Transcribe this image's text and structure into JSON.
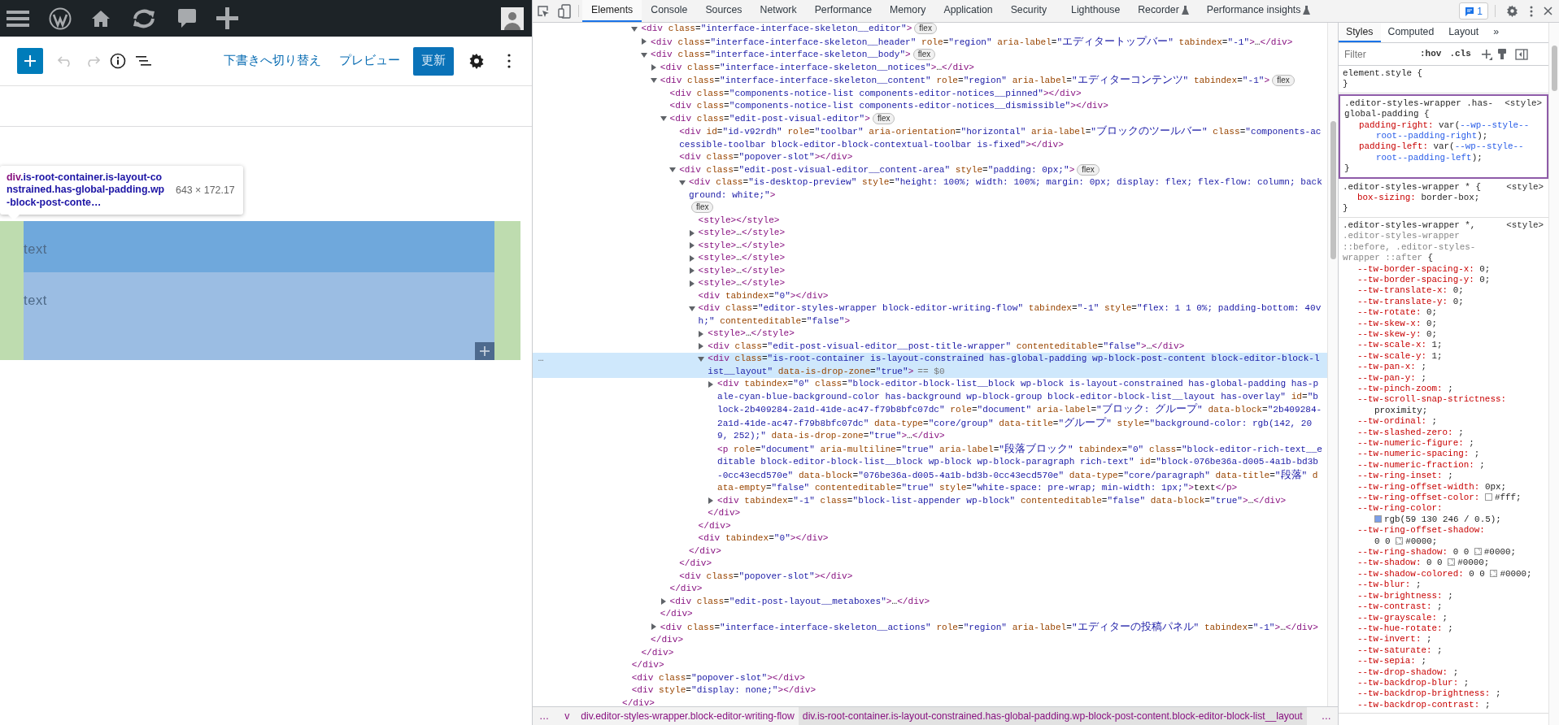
{
  "wp_editor": {
    "toolbar": {
      "undo": {
        "disabled": true
      },
      "redo": {
        "disabled": true
      },
      "links": [
        "下書きへ切り替え",
        "プレビュー"
      ],
      "update_button": "更新"
    },
    "tooltip": {
      "tag": "div",
      "classes": ".is-root-container.is-layout-constrained.has-global-padding.wp-block-post-conte…",
      "size": "643 × 172.17"
    },
    "blocks": [
      {
        "text": "text",
        "color": "#6fa8dc"
      },
      {
        "text": "text",
        "color": "#9bbde3"
      }
    ]
  },
  "devtools": {
    "tabs": [
      {
        "label": "Elements",
        "selected": true,
        "experimental": false
      },
      {
        "label": "Console",
        "selected": false,
        "experimental": false
      },
      {
        "label": "Sources",
        "selected": false,
        "experimental": false
      },
      {
        "label": "Network",
        "selected": false,
        "experimental": false
      },
      {
        "label": "Performance",
        "selected": false,
        "experimental": false
      },
      {
        "label": "Memory",
        "selected": false,
        "experimental": false
      },
      {
        "label": "Application",
        "selected": false,
        "experimental": false
      },
      {
        "label": "Security",
        "selected": false,
        "experimental": false
      },
      {
        "label": "Lighthouse",
        "selected": false,
        "experimental": false
      },
      {
        "label": "Recorder",
        "selected": false,
        "experimental": true
      },
      {
        "label": "Performance insights",
        "selected": false,
        "experimental": true
      }
    ],
    "issues_count": "1",
    "dom": {
      "children": [
        {
          "close": "</div>",
          "children": [
            {
              "close": "</div>",
              "children": [
                {
                  "open": "<div class=\"interface-interface-skeleton__editor\">",
                  "expanded": true,
                  "selected": false,
                  "badge": "flex",
                  "close": "</div>",
                  "children": [
                    {
                      "open": "<div class=\"interface-interface-skeleton__header\" role=\"region\" aria-label=\"エディタートップバー\" tabindex=\"-1\">…</div>",
                      "expanded": false,
                      "selected": false
                    },
                    {
                      "open": "<div class=\"interface-interface-skeleton__body\">",
                      "expanded": true,
                      "selected": false,
                      "badge": "flex",
                      "close": "</div>",
                      "children": [
                        {
                          "open": "<div class=\"interface-interface-skeleton__notices\">…</div>",
                          "expanded": false,
                          "selected": false
                        },
                        {
                          "open": "<div class=\"interface-interface-skeleton__content\" role=\"region\" aria-label=\"エディターコンテンツ\" tabindex=\"-1\">",
                          "expanded": true,
                          "selected": false,
                          "badge": "flex",
                          "close": "</div>",
                          "children": [
                            {
                              "open": "<div class=\"components-notice-list components-editor-notices__pinned\"></div>",
                              "selected": false
                            },
                            {
                              "open": "<div class=\"components-notice-list components-editor-notices__dismissible\"></div>",
                              "selected": false
                            },
                            {
                              "open": "<div class=\"edit-post-visual-editor\">",
                              "expanded": true,
                              "selected": false,
                              "badge": "flex",
                              "close": "</div>",
                              "children": [
                                {
                                  "open": "<div id=\"id-v92rdh\" role=\"toolbar\" aria-orientation=\"horizontal\" aria-label=\"ブロックのツールバー\" class=\"components-accessible-toolbar block-editor-block-contextual-toolbar is-fixed\"></div>",
                                  "selected": false
                                },
                                {
                                  "open": "<div class=\"popover-slot\"></div>",
                                  "selected": false
                                },
                                {
                                  "open": "<div class=\"edit-post-visual-editor__content-area\" style=\"padding: 0px;\">",
                                  "expanded": true,
                                  "selected": false,
                                  "badge": "flex",
                                  "close": "</div>",
                                  "children": [
                                    {
                                      "open": "<div class=\"is-desktop-preview\" style=\"height: 100%; width: 100%; margin: 0px; display: flex; flex-flow: column; background: white;\">",
                                      "expanded": true,
                                      "selected": false,
                                      "badge": "flex",
                                      "close": "</div>",
                                      "children": [
                                        {
                                          "open": "<style></style>",
                                          "selected": false
                                        },
                                        {
                                          "open": "<style>…</style>",
                                          "expanded": false,
                                          "selected": false
                                        },
                                        {
                                          "open": "<style>…</style>",
                                          "expanded": false,
                                          "selected": false
                                        },
                                        {
                                          "open": "<style>…</style>",
                                          "expanded": false,
                                          "selected": false
                                        },
                                        {
                                          "open": "<style>…</style>",
                                          "expanded": false,
                                          "selected": false
                                        },
                                        {
                                          "open": "<style>…</style>",
                                          "expanded": false,
                                          "selected": false
                                        },
                                        {
                                          "open": "<div tabindex=\"0\"></div>",
                                          "selected": false
                                        },
                                        {
                                          "open": "<div class=\"editor-styles-wrapper block-editor-writing-flow\" tabindex=\"-1\" style=\"flex: 1 1 0%; padding-bottom: 40vh;\" contenteditable=\"false\">",
                                          "expanded": true,
                                          "selected": false,
                                          "close": "</div>",
                                          "children": [
                                            {
                                              "open": "<style>…</style>",
                                              "expanded": false,
                                              "selected": false
                                            },
                                            {
                                              "open": "<div class=\"edit-post-visual-editor__post-title-wrapper\" contenteditable=\"false\">…</div>",
                                              "expanded": false,
                                              "selected": false
                                            },
                                            {
                                              "open": "<div class=\"is-root-container is-layout-constrained has-global-padding wp-block-post-content block-editor-block-list__layout\" data-is-drop-zone=\"true\">",
                                              "expanded": true,
                                              "selected": true,
                                              "gutter": "…",
                                              "marker": "== $0",
                                              "close": "</div>",
                                              "children": [
                                                {
                                                  "open": "<div tabindex=\"0\" class=\"block-editor-block-list__block wp-block is-layout-constrained has-global-padding has-pale-cyan-blue-background-color has-background wp-block-group block-editor-block-list__layout has-overlay\" id=\"block-2b409284-2a1d-41de-ac47-f79b8bfc07dc\" role=\"document\" aria-label=\"ブロック: グループ\" data-block=\"2b409284-2a1d-41de-ac47-f79b8bfc07dc\" data-type=\"core/group\" data-title=\"グループ\" style=\"background-color: rgb(142, 209, 252);\" data-is-drop-zone=\"true\">…</div>",
                                                  "expanded": false,
                                                  "selected": false
                                                },
                                                {
                                                  "open": "<p role=\"document\" aria-multiline=\"true\" aria-label=\"段落ブロック\" tabindex=\"0\" class=\"block-editor-rich-text__editable block-editor-block-list__block wp-block wp-block-paragraph rich-text\" id=\"block-076be36a-d005-4a1b-bd3b-0cc43ecd570e\" data-block=\"076be36a-d005-4a1b-bd3b-0cc43ecd570e\" data-type=\"core/paragraph\" data-title=\"段落\" data-empty=\"false\" contenteditable=\"true\" style=\"white-space: pre-wrap; min-width: 1px;\">text</p>",
                                                  "selected": false
                                                },
                                                {
                                                  "open": "<div tabindex=\"-1\" class=\"block-list-appender wp-block\" contenteditable=\"false\" data-block=\"true\">…</div>",
                                                  "expanded": false,
                                                  "selected": false
                                                }
                                              ]
                                            }
                                          ]
                                        },
                                        {
                                          "open": "<div tabindex=\"0\"></div>",
                                          "selected": false
                                        }
                                      ]
                                    }
                                  ]
                                },
                                {
                                  "open": "<div class=\"popover-slot\"></div>",
                                  "selected": false
                                }
                              ]
                            },
                            {
                              "open": "<div class=\"edit-post-layout__metaboxes\">…</div>",
                              "expanded": false,
                              "selected": false
                            }
                          ]
                        },
                        {
                          "open": "<div class=\"interface-interface-skeleton__actions\" role=\"region\" aria-label=\"エディターの投稿パネル\" tabindex=\"-1\">…</div>",
                          "expanded": false,
                          "selected": false
                        }
                      ]
                    }
                  ]
                }
              ]
            },
            {
              "open": "<div class=\"popover-slot\"></div>",
              "selected": false
            },
            {
              "open": "<div style=\"display: none;\"></div>",
              "selected": false
            }
          ]
        }
      ]
    },
    "breadcrumbs": {
      "lead": "…",
      "items": [
        {
          "text": "v",
          "selected": false
        },
        {
          "text": "div.editor-styles-wrapper.block-editor-writing-flow",
          "selected": false
        },
        {
          "text": "div.is-root-container.is-layout-constrained.has-global-padding.wp-block-post-content.block-editor-block-list__layout",
          "selected": true
        }
      ],
      "tail": "…"
    },
    "styles_tabs": [
      {
        "label": "Styles",
        "selected": true
      },
      {
        "label": "Computed",
        "selected": false
      },
      {
        "label": "Layout",
        "selected": false
      }
    ],
    "styles_more": "»",
    "filter": {
      "placeholder": "Filter",
      "buttons": [
        ":hov",
        ".cls"
      ]
    },
    "rules": [
      {
        "selector": [
          {
            "text": "element.style {",
            "matched": true
          }
        ],
        "highlighted": false,
        "close": "}"
      },
      {
        "selector": [
          {
            "text": ".editor-styles-wrapper .has-global-padding {",
            "matched": true
          }
        ],
        "source": "<style>",
        "highlighted": true,
        "close": "}",
        "declarations": [
          {
            "prop": "padding-right:",
            "value": "var(--wp--style--root--padding-right);"
          },
          {
            "prop": "padding-left:",
            "value": "var(--wp--style--root--padding-left);"
          }
        ]
      },
      {
        "selector": [
          {
            "text": ".editor-styles-wrapper * {",
            "matched": true
          }
        ],
        "source": "<style>",
        "highlighted": false,
        "close": "}",
        "declarations": [
          {
            "prop": "box-sizing:",
            "value": "border-box;"
          }
        ]
      },
      {
        "selector": [
          {
            "text": ".editor-styles-wrapper *,",
            "matched": true
          },
          {
            "text": ".editor-styles-wrapper ::before, .editor-styles-wrapper ::after",
            "matched": false
          },
          {
            "text": "{",
            "matched": true
          }
        ],
        "source": "<style>",
        "highlighted": false,
        "declarations": [
          {
            "prop": "--tw-border-spacing-x:",
            "value": "0;"
          },
          {
            "prop": "--tw-border-spacing-y:",
            "value": "0;"
          },
          {
            "prop": "--tw-translate-x:",
            "value": "0;"
          },
          {
            "prop": "--tw-translate-y:",
            "value": "0;"
          },
          {
            "prop": "--tw-rotate:",
            "value": "0;"
          },
          {
            "prop": "--tw-skew-x:",
            "value": "0;"
          },
          {
            "prop": "--tw-skew-y:",
            "value": "0;"
          },
          {
            "prop": "--tw-scale-x:",
            "value": "1;"
          },
          {
            "prop": "--tw-scale-y:",
            "value": "1;"
          },
          {
            "prop": "--tw-pan-x:",
            "value": ";"
          },
          {
            "prop": "--tw-pan-y:",
            "value": ";"
          },
          {
            "prop": "--tw-pinch-zoom:",
            "value": ";"
          },
          {
            "prop": "--tw-scroll-snap-strictness:",
            "value": "proximity;"
          },
          {
            "prop": "--tw-ordinal:",
            "value": ";"
          },
          {
            "prop": "--tw-slashed-zero:",
            "value": ";"
          },
          {
            "prop": "--tw-numeric-figure:",
            "value": ";"
          },
          {
            "prop": "--tw-numeric-spacing:",
            "value": ";"
          },
          {
            "prop": "--tw-numeric-fraction:",
            "value": ";"
          },
          {
            "prop": "--tw-ring-inset:",
            "value": ";"
          },
          {
            "prop": "--tw-ring-offset-width:",
            "value": "0px;"
          },
          {
            "prop": "--tw-ring-offset-color:",
            "value": "#fff;",
            "swatch": {
              "kind": "solid",
              "color": "#ffffff"
            }
          },
          {
            "prop": "--tw-ring-color:",
            "value": "rgb(59 130 246 / 0.5);",
            "swatch": {
              "kind": "solid",
              "color": "#7b9fe8"
            }
          },
          {
            "prop": "--tw-ring-offset-shadow:",
            "value": "0 0 #0000;",
            "swatch": {
              "kind": "checker"
            }
          },
          {
            "prop": "--tw-ring-shadow:",
            "value": "0 0 #0000;",
            "swatch": {
              "kind": "checker"
            }
          },
          {
            "prop": "--tw-shadow:",
            "value": "0 0 #0000;",
            "swatch": {
              "kind": "checker"
            }
          },
          {
            "prop": "--tw-shadow-colored:",
            "value": "0 0 #0000;",
            "swatch": {
              "kind": "checker"
            }
          },
          {
            "prop": "--tw-blur:",
            "value": ";"
          },
          {
            "prop": "--tw-brightness:",
            "value": ";"
          },
          {
            "prop": "--tw-contrast:",
            "value": ";"
          },
          {
            "prop": "--tw-grayscale:",
            "value": ";"
          },
          {
            "prop": "--tw-hue-rotate:",
            "value": ";"
          },
          {
            "prop": "--tw-invert:",
            "value": ";"
          },
          {
            "prop": "--tw-saturate:",
            "value": ";"
          },
          {
            "prop": "--tw-sepia:",
            "value": ";"
          },
          {
            "prop": "--tw-drop-shadow:",
            "value": ";"
          },
          {
            "prop": "--tw-backdrop-blur:",
            "value": ";"
          },
          {
            "prop": "--tw-backdrop-brightness:",
            "value": ";"
          },
          {
            "prop": "--tw-backdrop-contrast:",
            "value": ";"
          }
        ]
      }
    ]
  }
}
